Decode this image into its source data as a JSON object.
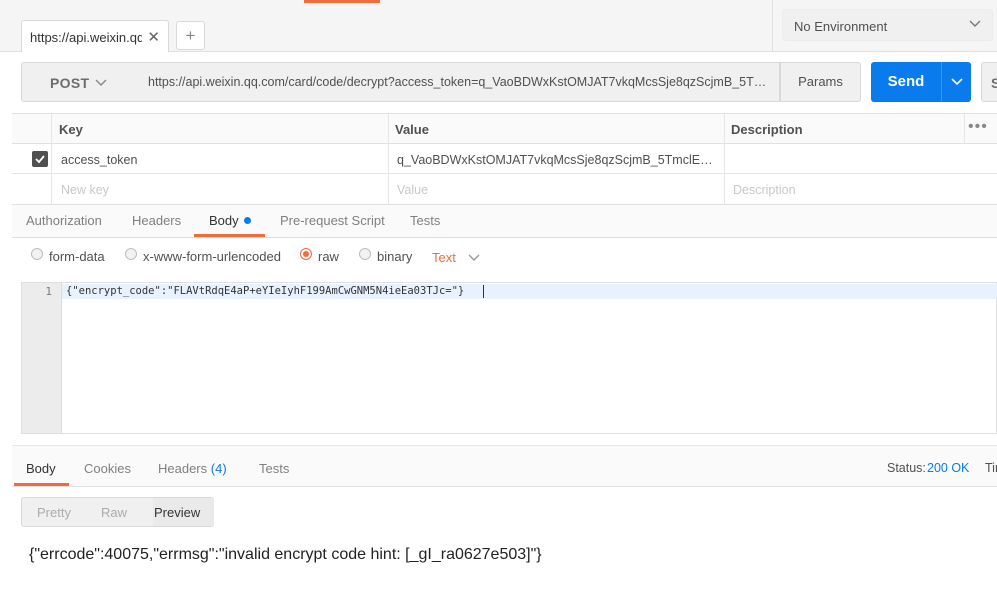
{
  "tabs": {
    "active_tab_label": "https://api.weixin.qq",
    "add_label": "+"
  },
  "environment": {
    "selected": "No Environment"
  },
  "request": {
    "method": "POST",
    "url": "https://api.weixin.qq.com/card/code/decrypt?access_token=q_VaoBDWxKstOMJAT7vkqMcsSje8qzScjmB_5Tmc..",
    "params_label": "Params",
    "send_label": "Send",
    "save_label": "S"
  },
  "params_table": {
    "headers": [
      "Key",
      "Value",
      "Description"
    ],
    "rows": [
      {
        "key": "access_token",
        "value": "q_VaoBDWxKstOMJAT7vkqMcsSje8qzScjmB_5TmclE9Ba...",
        "description": "",
        "checked": true
      }
    ],
    "placeholders": {
      "key": "New key",
      "value": "Value",
      "description": "Description"
    },
    "more": "•••"
  },
  "request_tabs": [
    "Authorization",
    "Headers",
    "Body",
    "Pre-request Script",
    "Tests"
  ],
  "request_active_tab": "Body",
  "body_types": [
    "form-data",
    "x-www-form-urlencoded",
    "raw",
    "binary"
  ],
  "body_type_selected": "raw",
  "raw_format": "Text",
  "editor": {
    "line_number": "1",
    "code": "{\"encrypt_code\":\"FLAVtRdqE4aP+eYIeIyhF199AmCwGNM5N4ieEa03TJc=\"}"
  },
  "response_tabs": {
    "body": "Body",
    "cookies": "Cookies",
    "headers": "Headers",
    "headers_count": "(4)",
    "tests": "Tests"
  },
  "response_status": {
    "label": "Status:",
    "value": "200 OK",
    "time_label": "Tim"
  },
  "response_formats": [
    "Pretty",
    "Raw",
    "Preview"
  ],
  "response_format_selected": "Preview",
  "response_body": "{\"errcode\":40075,\"errmsg\":\"invalid encrypt code hint: [_gI_ra0627e503]\"}",
  "colors": {
    "accent": "#f26b3a",
    "primary": "#097bed"
  }
}
